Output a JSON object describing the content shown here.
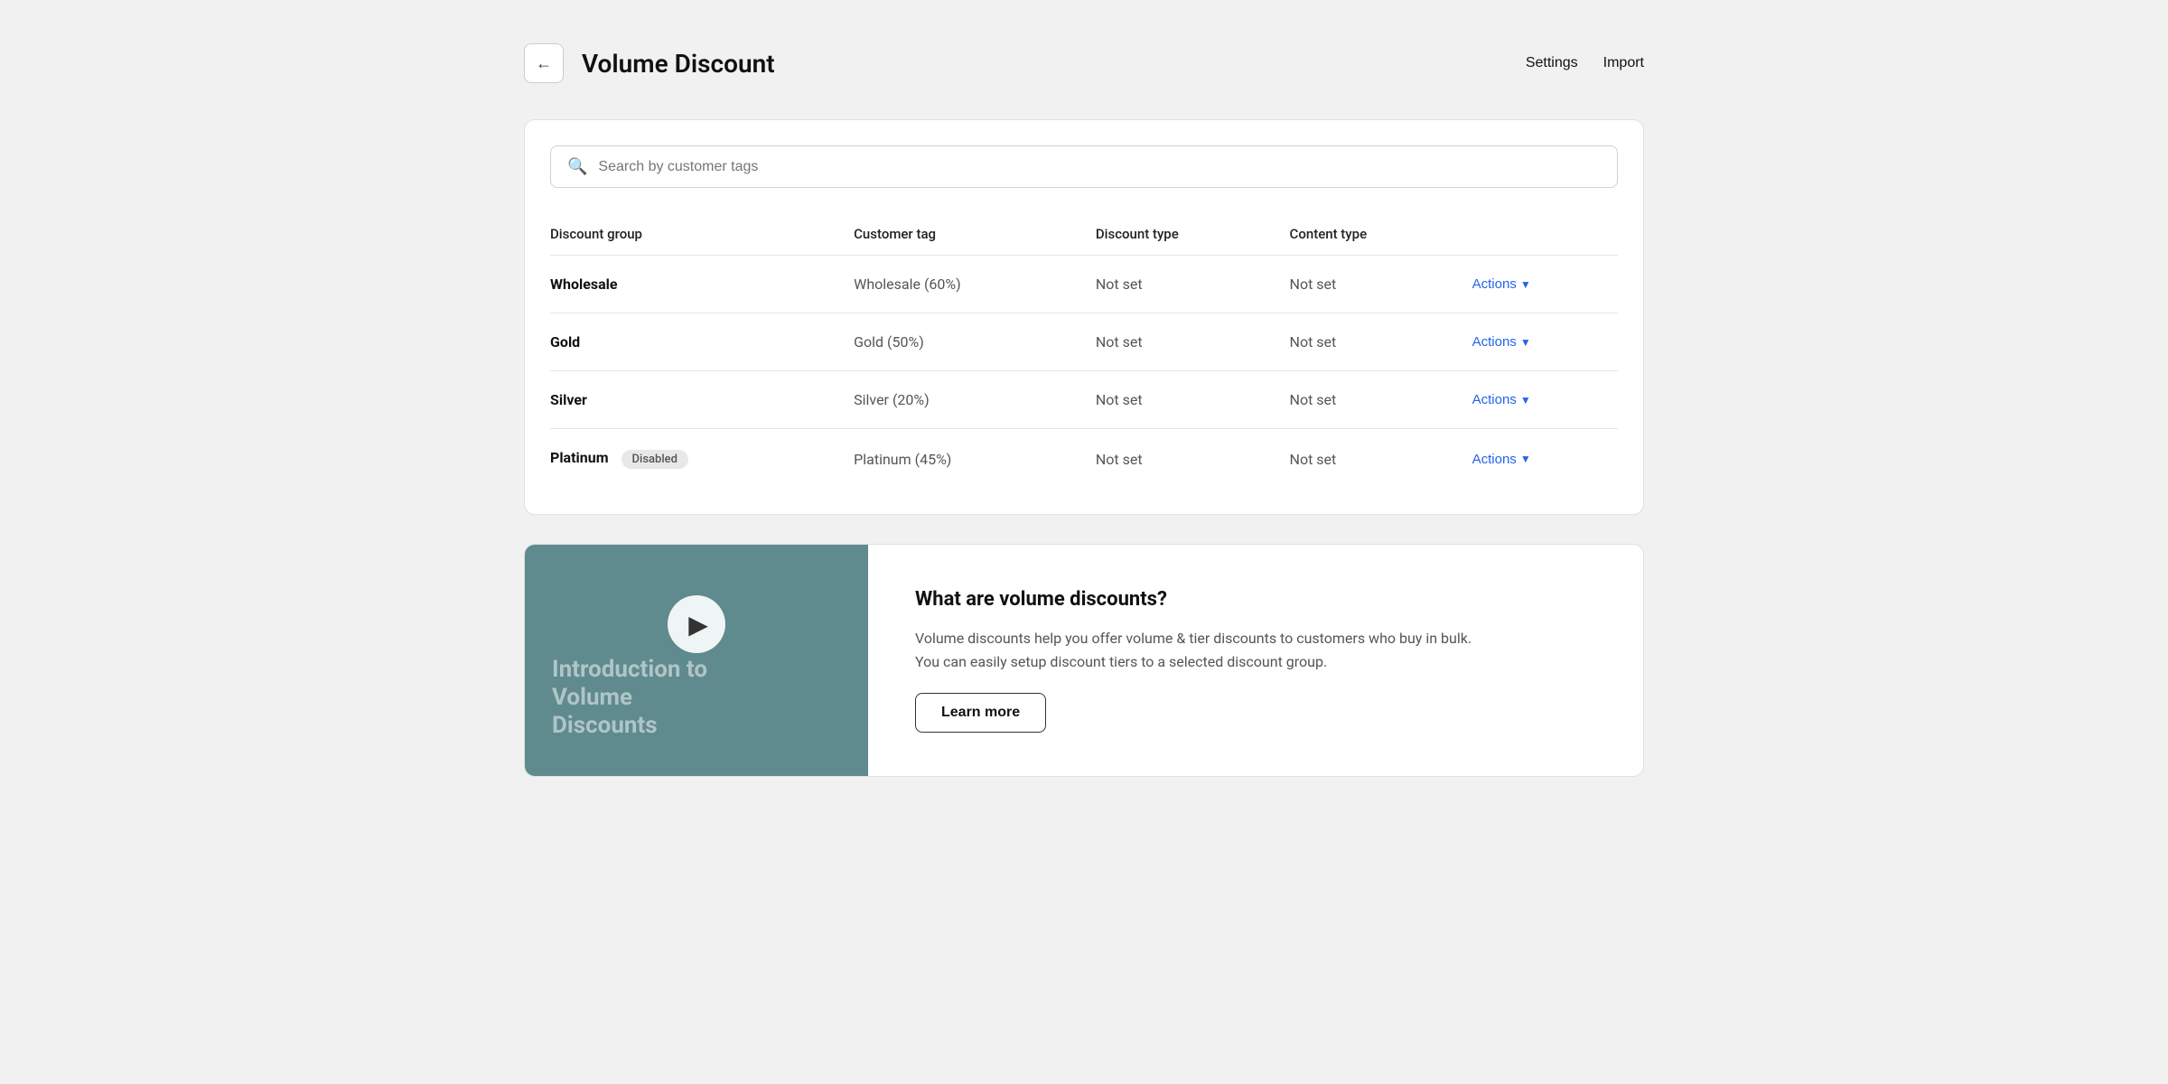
{
  "header": {
    "title": "Volume Discount",
    "settings_label": "Settings",
    "import_label": "Import",
    "back_aria": "Back"
  },
  "search": {
    "placeholder": "Search by customer tags"
  },
  "table": {
    "columns": [
      {
        "key": "group",
        "label": "Discount group"
      },
      {
        "key": "tag",
        "label": "Customer tag"
      },
      {
        "key": "discount_type",
        "label": "Discount type"
      },
      {
        "key": "content_type",
        "label": "Content type"
      },
      {
        "key": "actions",
        "label": ""
      }
    ],
    "rows": [
      {
        "group": "Wholesale",
        "disabled": false,
        "tag": "Wholesale (60%)",
        "discount_type": "Not set",
        "content_type": "Not set",
        "actions": "Actions"
      },
      {
        "group": "Gold",
        "disabled": false,
        "tag": "Gold (50%)",
        "discount_type": "Not set",
        "content_type": "Not set",
        "actions": "Actions"
      },
      {
        "group": "Silver",
        "disabled": false,
        "tag": "Silver (20%)",
        "discount_type": "Not set",
        "content_type": "Not set",
        "actions": "Actions"
      },
      {
        "group": "Platinum",
        "disabled": true,
        "disabled_label": "Disabled",
        "tag": "Platinum (45%)",
        "discount_type": "Not set",
        "content_type": "Not set",
        "actions": "Actions"
      }
    ]
  },
  "info_section": {
    "video_text_line1": "Introduction to",
    "video_text_line2": "Volume",
    "video_text_line3": "Discounts",
    "title": "What are volume discounts?",
    "description_line1": "Volume discounts help you offer volume & tier discounts to customers who buy in bulk.",
    "description_line2": "You can easily setup discount tiers to a selected discount group.",
    "learn_more_label": "Learn more"
  },
  "icons": {
    "back": "←",
    "search": "🔍",
    "play": "▶",
    "chevron_down": "▼"
  }
}
